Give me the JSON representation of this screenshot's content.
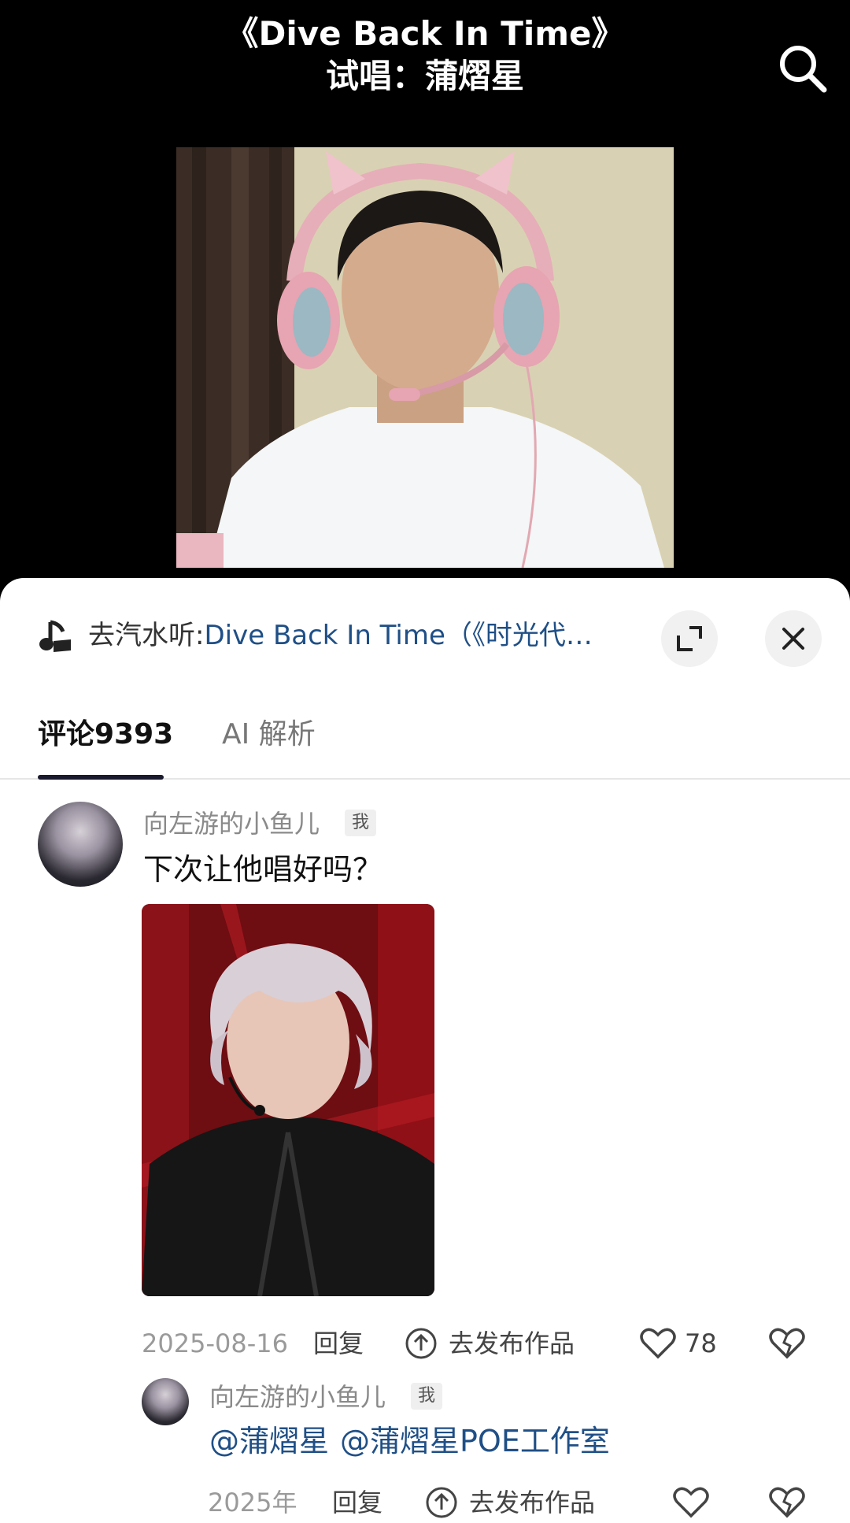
{
  "video": {
    "title_line1": "《Dive Back In Time》",
    "title_line2": "试唱：蒲熠星"
  },
  "music_bar": {
    "prefix": "去汽水听:",
    "song": "Dive Back In Time（《时光代…"
  },
  "tabs": {
    "comments": "评论9393",
    "ai": "AI 解析"
  },
  "comments": [
    {
      "username": "向左游的小鱼儿",
      "badge": "我",
      "text": "下次让他唱好吗？",
      "date": "2025-08-16",
      "reply": "回复",
      "publish": "去发布作品",
      "likes": "78"
    },
    {
      "username": "向左游的小鱼儿",
      "badge": "我",
      "mentions": [
        "@蒲熠星",
        "@蒲熠星POE工作室"
      ],
      "date": "2025年",
      "reply": "回复",
      "publish": "去发布作品"
    }
  ],
  "colors": {
    "accent_link": "#1f4f86",
    "tab_indicator": "#1a1a2e",
    "video_bg": "#000000"
  },
  "icons": {
    "search": "search-icon",
    "music": "music-note-icon",
    "expand": "expand-icon",
    "close": "close-icon",
    "publish": "upload-circle-icon",
    "like": "heart-icon",
    "dislike": "broken-heart-icon"
  }
}
